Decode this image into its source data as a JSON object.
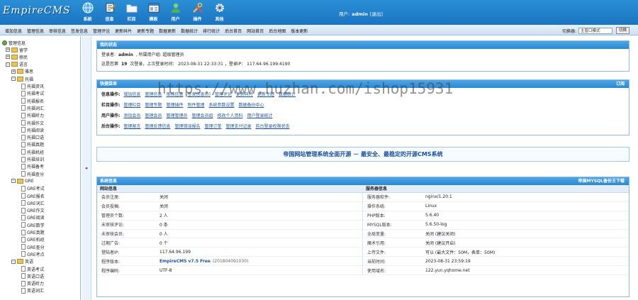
{
  "header": {
    "logo": "EmpireCMS",
    "nav": [
      {
        "label": "系统",
        "icon": "globe-icon"
      },
      {
        "label": "信息",
        "icon": "document-icon"
      },
      {
        "label": "栏目",
        "icon": "folder-icon"
      },
      {
        "label": "模板",
        "icon": "template-icon"
      },
      {
        "label": "用户",
        "icon": "user-icon"
      },
      {
        "label": "插件",
        "icon": "tools-icon"
      },
      {
        "label": "其他",
        "icon": "gear-icon"
      }
    ],
    "user_label": "用户:",
    "username": "admin",
    "logout": "[退出]"
  },
  "quickbar": {
    "items": [
      "增加信息",
      "管理信息",
      "审核信息",
      "签发信息",
      "管理评论",
      "更新碎片",
      "更新专题",
      "数据更新",
      "数据统计",
      "排行统计",
      "后台首页",
      "网站首页",
      "后台地图",
      "版本更新"
    ],
    "mode_label": "切换器:",
    "mode_value": "主窗口模式",
    "switch_button": "切换"
  },
  "sidebar": {
    "title": "管理信息",
    "tree": [
      {
        "label": "留学",
        "type": "folder",
        "level": 1,
        "expand": "+"
      },
      {
        "label": "移民",
        "type": "folder",
        "level": 1,
        "expand": "+"
      },
      {
        "label": "语言",
        "type": "folder",
        "level": 1,
        "expand": "-"
      },
      {
        "label": "雅思",
        "type": "folder",
        "level": 2,
        "expand": "+"
      },
      {
        "label": "托福",
        "type": "folder",
        "level": 2,
        "expand": "-"
      },
      {
        "label": "托福资讯",
        "type": "page",
        "level": 3
      },
      {
        "label": "托福考试",
        "type": "page",
        "level": 3
      },
      {
        "label": "托福报名",
        "type": "page",
        "level": 3
      },
      {
        "label": "托福词汇",
        "type": "page",
        "level": 3
      },
      {
        "label": "托福听力",
        "type": "page",
        "level": 3
      },
      {
        "label": "托福作文",
        "type": "page",
        "level": 3
      },
      {
        "label": "托福阅读",
        "type": "page",
        "level": 3
      },
      {
        "label": "托福口语",
        "type": "page",
        "level": 3
      },
      {
        "label": "托福真题",
        "type": "page",
        "level": 3
      },
      {
        "label": "托福机经",
        "type": "page",
        "level": 3
      },
      {
        "label": "托福培训",
        "type": "page",
        "level": 3
      },
      {
        "label": "托福备考",
        "type": "page",
        "level": 3
      },
      {
        "label": "托福查分",
        "type": "page",
        "level": 3
      },
      {
        "label": "GRE",
        "type": "folder",
        "level": 2,
        "expand": "-"
      },
      {
        "label": "GRE考试",
        "type": "page",
        "level": 3
      },
      {
        "label": "GRE报名",
        "type": "page",
        "level": 3
      },
      {
        "label": "GRE词汇",
        "type": "page",
        "level": 3
      },
      {
        "label": "GRE作文",
        "type": "page",
        "level": 3
      },
      {
        "label": "GRE阅读",
        "type": "page",
        "level": 3
      },
      {
        "label": "GRE数学",
        "type": "page",
        "level": 3
      },
      {
        "label": "GRE真题",
        "type": "page",
        "level": 3
      },
      {
        "label": "GRE机经",
        "type": "page",
        "level": 3
      },
      {
        "label": "GRE查分",
        "type": "page",
        "level": 3
      },
      {
        "label": "GRE考点",
        "type": "page",
        "level": 3
      },
      {
        "label": "英语",
        "type": "folder",
        "level": 2,
        "expand": "-"
      },
      {
        "label": "英语考试",
        "type": "page",
        "level": 3
      },
      {
        "label": "英语口语",
        "type": "page",
        "level": 3
      },
      {
        "label": "英语听力",
        "type": "page",
        "level": 3
      },
      {
        "label": "英语词汇",
        "type": "page",
        "level": 3
      }
    ]
  },
  "status_panel": {
    "title": "我的状态",
    "line1_label": "登录者:",
    "line1_user": "admin",
    "line1_rest": ", 所属用户组: 超级管理员",
    "line2_pre": "这是您第",
    "login_count": "19",
    "line2_mid": "次登录，上次登录时间：",
    "last_time": "2023-08-31 22:33:31",
    "line2_ip_label": "，登录IP：",
    "last_ip": "117.64.96.199:4190"
  },
  "quick_panel": {
    "title": "快捷菜单",
    "right": "订阅",
    "rows": [
      {
        "label": "信息操作:",
        "links": [
          "增加信息",
          "管理信息",
          "审核信息",
          "签发信息(0)",
          "管理评论",
          "更新碎片",
          "更新专题",
          "数据统计"
        ]
      },
      {
        "label": "栏目操作:",
        "links": [
          "管理栏目",
          "管理专题",
          "管理插件",
          "附件管理",
          "系统参数设置",
          "数据备份中心"
        ]
      },
      {
        "label": "用户操作:",
        "links": [
          "添加会员",
          "管理会员",
          "管理管理员",
          "管理会员组",
          "修改个人资料",
          "用户登录统计"
        ]
      },
      {
        "label": "后台操作:",
        "links": [
          "管理留言",
          "管理反馈信息",
          "管理错误报告",
          "管理订单",
          "管理支付记录",
          "前台登录权限状态"
        ]
      }
    ]
  },
  "banner": "帝国网站管理系统全面开源 － 最安全、最稳定的开源CMS系统",
  "sysinfo_panel": {
    "title": "系统信息",
    "right": "帝国MYSQL备份王下载",
    "left_title": "网站信息",
    "right_title": "服务器信息",
    "left_rows": [
      {
        "k": "会员注册:",
        "v": "关闭"
      },
      {
        "k": "会员投稿:",
        "v": "关闭"
      },
      {
        "k": "管理员个数:",
        "v": "2 人"
      },
      {
        "k": "未审核评论:",
        "v": "0 条"
      },
      {
        "k": "未审核会员:",
        "v": "0 人"
      },
      {
        "k": "过期广告:",
        "v": "0 个"
      },
      {
        "k": "登陆者IP:",
        "v": "117.64.96.199"
      },
      {
        "k": "程序版本:",
        "v": "EmpireCMS v7.5 Free",
        "v2": "(201804091030)"
      },
      {
        "k": "程序编码:",
        "v": "UTF-8"
      }
    ],
    "right_rows": [
      {
        "k": "服务器软件:",
        "v": "nginx/1.20.1"
      },
      {
        "k": "操作系统:",
        "v": "Linux"
      },
      {
        "k": "PHP版本:",
        "v": "5.6.40"
      },
      {
        "k": "MYSQL版本:",
        "v": "5.6.50-log"
      },
      {
        "k": "全局变量:",
        "v": "关闭 (建议关闭)"
      },
      {
        "k": "魔术引用:",
        "v": "关闭 (建议开启)"
      },
      {
        "k": "上传文件:",
        "v": "可以 (最大文件：50M，表单：50M)"
      },
      {
        "k": "当前时间:",
        "v": "2023-08-31 23:59:19"
      },
      {
        "k": "使用域名:",
        "v": "122.yun.yqhome.net"
      }
    ]
  },
  "watermark": "https://www.huzhan.com/ishop15931",
  "colors": {
    "header": "#1a74c2",
    "panel_head": "#2b88d2",
    "link": "#1e56a0",
    "banner_text": "#1a4fa0"
  }
}
